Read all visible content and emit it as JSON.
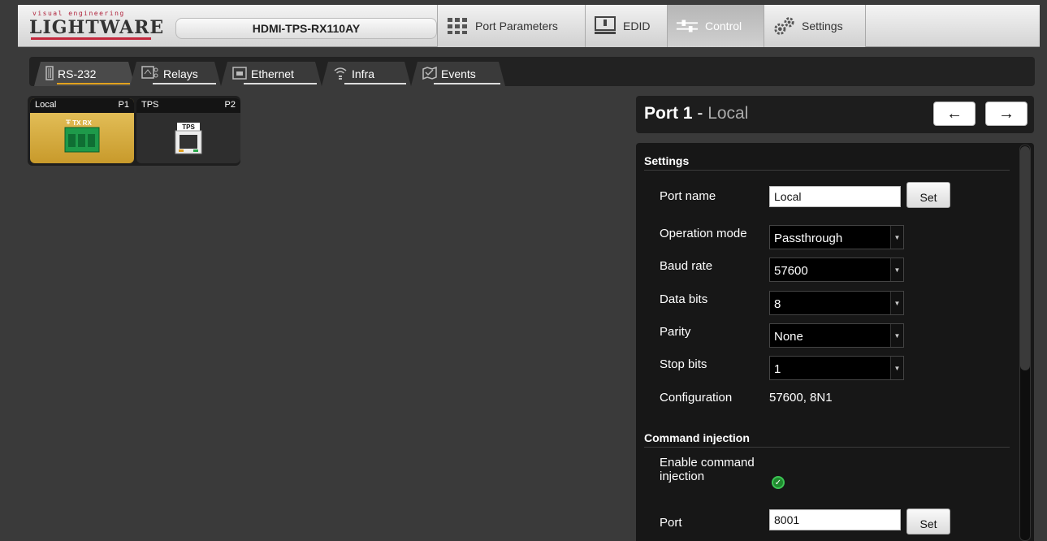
{
  "header": {
    "logo_tag": "visual engineering",
    "logo_text": "LIGHTWARE",
    "device_name": "HDMI-TPS-RX110AY",
    "tabs": [
      {
        "label": "Port Parameters",
        "icon": "grid-icon"
      },
      {
        "label": "EDID",
        "icon": "monitor-icon"
      },
      {
        "label": "Control",
        "icon": "sliders-icon",
        "active": true
      },
      {
        "label": "Settings",
        "icon": "gears-icon"
      }
    ]
  },
  "subtabs": [
    {
      "label": "RS-232",
      "icon": "serial-icon",
      "active": true
    },
    {
      "label": "Relays",
      "icon": "relay-icon"
    },
    {
      "label": "Ethernet",
      "icon": "ethernet-icon"
    },
    {
      "label": "Infra",
      "icon": "wifi-icon"
    },
    {
      "label": "Events",
      "icon": "events-icon"
    }
  ],
  "ports": [
    {
      "name": "Local",
      "id": "P1",
      "connector_label": "TX RX",
      "icon": "phoenix-connector-icon"
    },
    {
      "name": "TPS",
      "id": "P2",
      "connector_label": "TPS",
      "icon": "rj45-icon"
    }
  ],
  "panel": {
    "title_bold": "Port 1",
    "title_sep": " - ",
    "title_light": "Local",
    "prev_label": "←",
    "next_label": "→",
    "settings_title": "Settings",
    "port_name_label": "Port name",
    "port_name_value": "Local",
    "set_label": "Set",
    "operation_mode_label": "Operation mode",
    "operation_mode_value": "Passthrough",
    "baud_rate_label": "Baud rate",
    "baud_rate_value": "57600",
    "data_bits_label": "Data bits",
    "data_bits_value": "8",
    "parity_label": "Parity",
    "parity_value": "None",
    "stop_bits_label": "Stop bits",
    "stop_bits_value": "1",
    "configuration_label": "Configuration",
    "configuration_value": "57600, 8N1",
    "cmd_title": "Command injection",
    "enable_cmd_label_1": "Enable command",
    "enable_cmd_label_2": "injection",
    "enable_cmd_checked": true,
    "port_label": "Port",
    "port_value": "8001"
  },
  "colors": {
    "accent": "#e2a21e",
    "local_tile": "#d9b146",
    "brand_red": "#c3283d",
    "check_green": "#1f8a2e"
  }
}
